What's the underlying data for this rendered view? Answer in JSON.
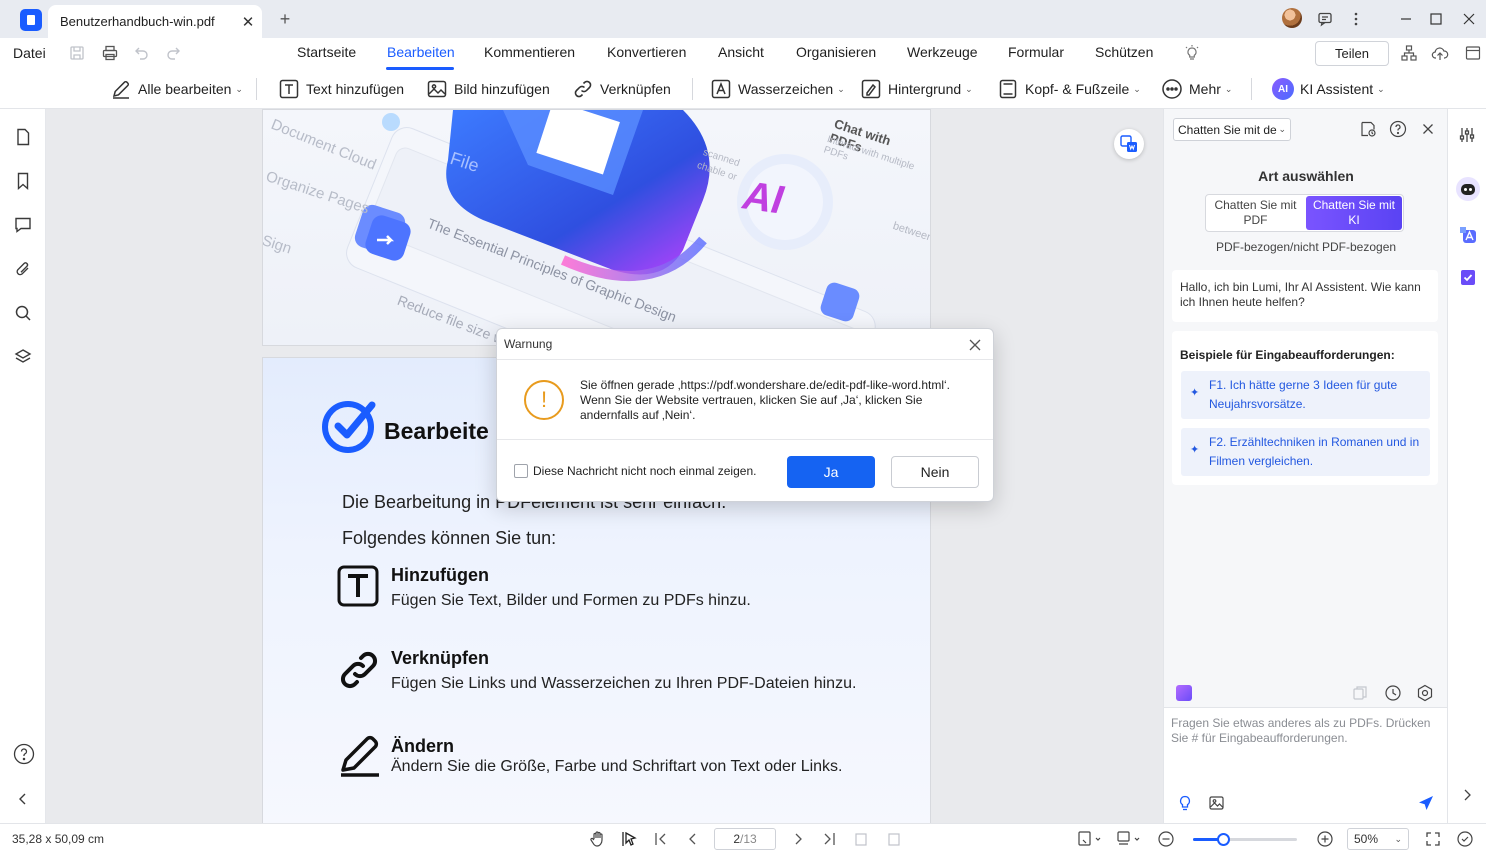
{
  "window": {
    "tab_title": "Benutzerhandbuch-win.pdf",
    "new_tab": "+"
  },
  "menu": {
    "file": "Datei",
    "tabs": [
      "Startseite",
      "Bearbeiten",
      "Kommentieren",
      "Konvertieren",
      "Ansicht",
      "Organisieren",
      "Werkzeuge",
      "Formular",
      "Schützen"
    ],
    "active_tab": "Bearbeiten",
    "share": "Teilen"
  },
  "toolbar": {
    "edit_all": "Alle bearbeiten",
    "add_text": "Text hinzufügen",
    "add_image": "Bild hinzufügen",
    "link": "Verknüpfen",
    "watermark": "Wasserzeichen",
    "background": "Hintergrund",
    "header_footer": "Kopf- & Fußzeile",
    "more": "Mehr",
    "ai_assistant": "KI Assistent",
    "ai_badge": "AI"
  },
  "page1": {
    "chat_with_pdfs": "Chat with PDFs",
    "interact": "Interact with multiple PDFs",
    "document_cloud": "Document Cloud",
    "organize_pages": "Organize Pages",
    "sign": "Sign",
    "graphic_design": "The Essential Principles of Graphic Design",
    "reduce": "Reduce file size wh",
    "ai": "AI",
    "file": "File",
    "scanned": "scanned",
    "chable_or": "chable or",
    "between": "between"
  },
  "page2": {
    "heading": "Bearbeite",
    "intro": "Die Bearbeitung in PDFelement ist sehr einfach.",
    "intro2": "Folgendes können Sie tun:",
    "items": [
      {
        "title": "Hinzufügen",
        "desc": "Fügen Sie Text, Bilder und Formen zu PDFs hinzu."
      },
      {
        "title": "Verknüpfen",
        "desc": "Fügen Sie Links und Wasserzeichen zu Ihren PDF-Dateien hinzu."
      },
      {
        "title": "Ändern",
        "desc": "Ändern Sie die Größe, Farbe und Schriftart von Text oder Links."
      }
    ]
  },
  "dialog": {
    "title": "Warnung",
    "message": "Sie öffnen gerade ‚https://pdf.wondershare.de/edit-pdf-like-word.html‘. Wenn Sie der Website vertrauen, klicken Sie auf ‚Ja‘, klicken Sie andernfalls auf ‚Nein‘.",
    "checkbox": "Diese Nachricht nicht noch einmal zeigen.",
    "yes": "Ja",
    "no": "Nein",
    "warn_glyph": "!"
  },
  "ai_panel": {
    "select_value": "Chatten Sie mit de",
    "choose_type": "Art auswählen",
    "seg_pdf": "Chatten Sie mit PDF",
    "seg_ki": "Chatten Sie mit KI",
    "sub": "PDF-bezogen/nicht PDF-bezogen",
    "greeting": "Hallo, ich bin Lumi, Ihr AI Assistent. Wie kann ich Ihnen heute helfen?",
    "examples_title": "Beispiele für Eingabeaufforderungen:",
    "examples": [
      "F1. Ich hätte gerne 3 Ideen für gute Neujahrsvorsätze.",
      "F2. Erzähltechniken in Romanen und in Filmen vergleichen."
    ],
    "placeholder": "Fragen Sie etwas anderes als zu PDFs. Drücken Sie # für Eingabeaufforderungen."
  },
  "status": {
    "dimensions": "35,28 x 50,09 cm",
    "page_current": "2",
    "page_total": "/13",
    "zoom": "50%",
    "zoom_level": 0.29
  },
  "colors": {
    "accent": "#1a5cff",
    "ai_purple": "#6a4cf8",
    "warning": "#e89b1e"
  }
}
